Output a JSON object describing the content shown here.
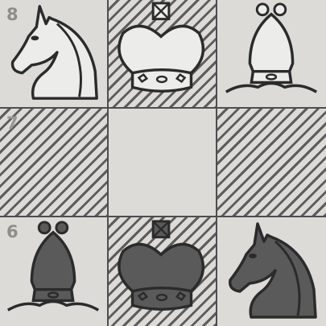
{
  "board": {
    "rank_labels": [
      "8",
      "7",
      "6"
    ],
    "squares": [
      {
        "square": "a8",
        "piece": "white-knight",
        "pattern": "plain"
      },
      {
        "square": "b8",
        "piece": "white-king",
        "pattern": "hatched"
      },
      {
        "square": "c8",
        "piece": "white-bishop",
        "pattern": "plain"
      },
      {
        "square": "a7",
        "piece": "",
        "pattern": "hatched"
      },
      {
        "square": "b7",
        "piece": "",
        "pattern": "plain"
      },
      {
        "square": "c7",
        "piece": "",
        "pattern": "hatched"
      },
      {
        "square": "a6",
        "piece": "black-bishop",
        "pattern": "plain"
      },
      {
        "square": "b6",
        "piece": "black-king",
        "pattern": "hatched"
      },
      {
        "square": "c6",
        "piece": "black-knight",
        "pattern": "plain"
      }
    ],
    "colors": {
      "light_square": "#dddbd7",
      "hatch": "#5c5c5c",
      "white_piece": "#ececea",
      "black_piece": "#5a5a5a",
      "outline": "#2b2b2b"
    }
  }
}
